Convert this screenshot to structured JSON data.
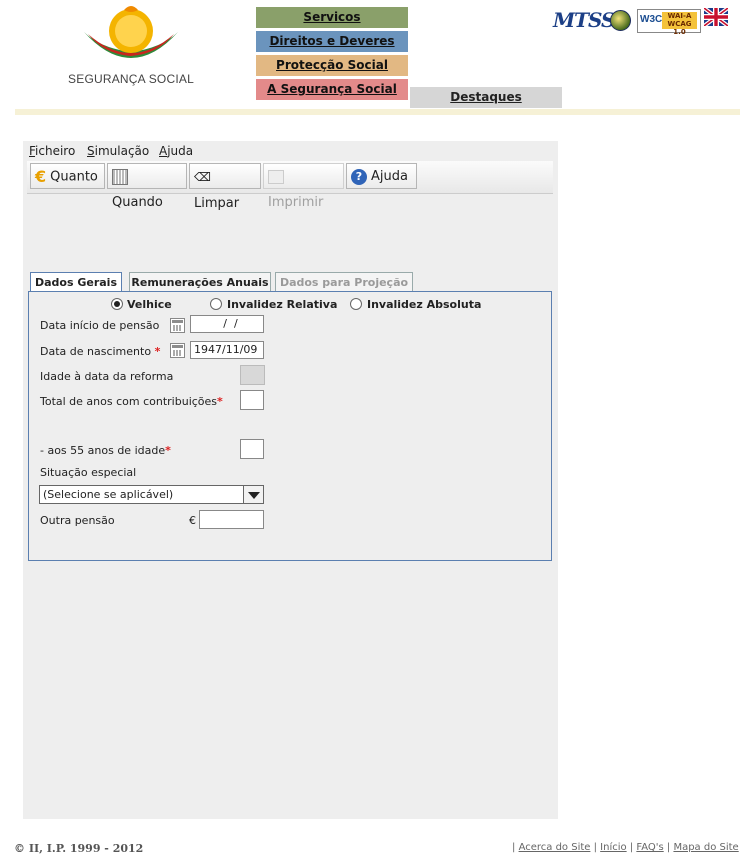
{
  "brand": {
    "logo_text": "SEGURANÇA SOCIAL",
    "mtss_label": "MTSS"
  },
  "nav": {
    "items": [
      "Servicos",
      "Direitos e Deveres",
      "Protecção Social",
      "A Segurança Social"
    ],
    "destaques": "Destaques"
  },
  "badges": {
    "w3c": "W3C",
    "wai_line1": "WAI-A",
    "wai_line2": "WCAG 1.0"
  },
  "menu": {
    "file": "F",
    "file_rest": "icheiro",
    "sim": "S",
    "sim_rest": "imulação",
    "help": "A",
    "help_rest": "juda"
  },
  "toolbar": {
    "quanto": "Quanto",
    "quando": "Quando",
    "limpar": "Limpar",
    "imprimir": "Imprimir",
    "ajuda": "Ajuda"
  },
  "tabs": [
    "Dados Gerais",
    "Remunerações Anuais",
    "Dados para Projeção"
  ],
  "form": {
    "radio_velhice": "Velhice",
    "radio_invalidez_relativa": "Invalidez Relativa",
    "radio_invalidez_absoluta": "Invalidez Absoluta",
    "data_inicio_label": "Data início de pensão",
    "data_inicio_value": "  /  /",
    "data_nascimento_label": "Data de nascimento",
    "data_nascimento_value": "1947/11/09",
    "idade_label": "Idade à data da reforma",
    "total_anos_label": "Total de anos com contribuições",
    "aos55_label": "- aos 55 anos de idade",
    "situacao_label": "Situação especial",
    "situacao_value": "(Selecione se aplicável)",
    "outra_pensao_label": "Outra pensão",
    "currency": "€",
    "required_mark": "*"
  },
  "footer": {
    "copyright": "© II, I.P. 1999 - 2012",
    "links": [
      "Acerca do Site",
      "Início",
      "FAQ's",
      "Mapa do Site"
    ]
  },
  "colors": {
    "nav1": "#8aa06a",
    "nav2": "#6b94bd",
    "nav3": "#e2b883",
    "nav4": "#e38a8a",
    "form_border": "#5b7fb0"
  }
}
